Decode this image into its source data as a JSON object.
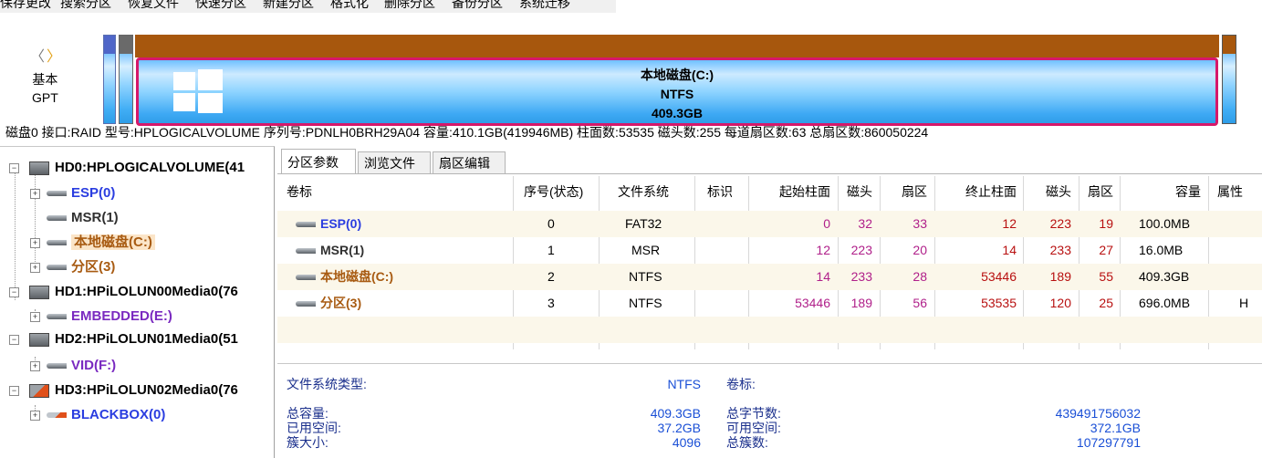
{
  "toolbar": {
    "items": [
      "保存更改",
      "搜索分区",
      "恢复文件",
      "快速分区",
      "新建分区",
      "格式化",
      "删除分区",
      "备份分区",
      "系统迁移"
    ]
  },
  "diskmap": {
    "nav": {
      "back": "〈",
      "forward": "〉"
    },
    "disk_type": "基本",
    "partition_style": "GPT",
    "selected_partition": {
      "name": "本地磁盘(C:)",
      "fs": "NTFS",
      "size": "409.3GB"
    }
  },
  "disk_info": "磁盘0 接口:RAID  型号:HPLOGICALVOLUME  序列号:PDNLH0BRH29A04  容量:410.1GB(419946MB)  柱面数:53535  磁头数:255  每道扇区数:63  总扇区数:860050224",
  "tree": {
    "nodes": [
      {
        "label": "HD0:HPLOGICALVOLUME(41",
        "type": "disk"
      },
      {
        "label": "ESP(0)",
        "type": "partition"
      },
      {
        "label": "MSR(1)",
        "type": "partition"
      },
      {
        "label": "本地磁盘(C:)",
        "type": "partition",
        "selected": true
      },
      {
        "label": "分区(3)",
        "type": "partition"
      },
      {
        "label": "HD1:HPiLOLUN00Media0(76",
        "type": "disk"
      },
      {
        "label": "EMBEDDED(E:)",
        "type": "partition"
      },
      {
        "label": "HD2:HPiLOLUN01Media0(51",
        "type": "disk"
      },
      {
        "label": "VID(F:)",
        "type": "partition"
      },
      {
        "label": "HD3:HPiLOLUN02Media0(76",
        "type": "disk"
      },
      {
        "label": "BLACKBOX(0)",
        "type": "partition"
      }
    ]
  },
  "tabs": [
    "分区参数",
    "浏览文件",
    "扇区编辑"
  ],
  "table": {
    "headers": [
      "卷标",
      "序号(状态)",
      "文件系统",
      "标识",
      "起始柱面",
      "磁头",
      "扇区",
      "终止柱面",
      "磁头",
      "扇区",
      "容量",
      "属性"
    ],
    "rows": [
      {
        "label": "ESP(0)",
        "index": "0",
        "fs": "FAT32",
        "flag": "",
        "start_cyl": "0",
        "start_head": "32",
        "start_sec": "33",
        "end_cyl": "12",
        "end_head": "223",
        "end_sec": "19",
        "size": "100.0MB",
        "attr": ""
      },
      {
        "label": "MSR(1)",
        "index": "1",
        "fs": "MSR",
        "flag": "",
        "start_cyl": "12",
        "start_head": "223",
        "start_sec": "20",
        "end_cyl": "14",
        "end_head": "233",
        "end_sec": "27",
        "size": "16.0MB",
        "attr": ""
      },
      {
        "label": "本地磁盘(C:)",
        "index": "2",
        "fs": "NTFS",
        "flag": "",
        "start_cyl": "14",
        "start_head": "233",
        "start_sec": "28",
        "end_cyl": "53446",
        "end_head": "189",
        "end_sec": "55",
        "size": "409.3GB",
        "attr": ""
      },
      {
        "label": "分区(3)",
        "index": "3",
        "fs": "NTFS",
        "flag": "",
        "start_cyl": "53446",
        "start_head": "189",
        "start_sec": "56",
        "end_cyl": "53535",
        "end_head": "120",
        "end_sec": "25",
        "size": "696.0MB",
        "attr": "H"
      }
    ]
  },
  "details": {
    "fs_type_label": "文件系统类型:",
    "fs_type_value": "NTFS",
    "volume_label": "卷标:",
    "volume_value": "",
    "total_label": "总容量:",
    "total_value": "409.3GB",
    "total_bytes_label": "总字节数:",
    "total_bytes_value": "439491756032",
    "used_label": "已用空间:",
    "used_value": "37.2GB",
    "free_label": "可用空间:",
    "free_value": "372.1GB",
    "cluster_label": "簇大小:",
    "cluster_value": "4096",
    "total_clusters_label": "总簇数:",
    "total_clusters_value": "107297791"
  },
  "colors": {
    "partition_c_border": "#d6186a",
    "ntfs_top": "#a7570d",
    "esp_top": "#4f66c8",
    "msr_top": "#6a6a6a"
  }
}
